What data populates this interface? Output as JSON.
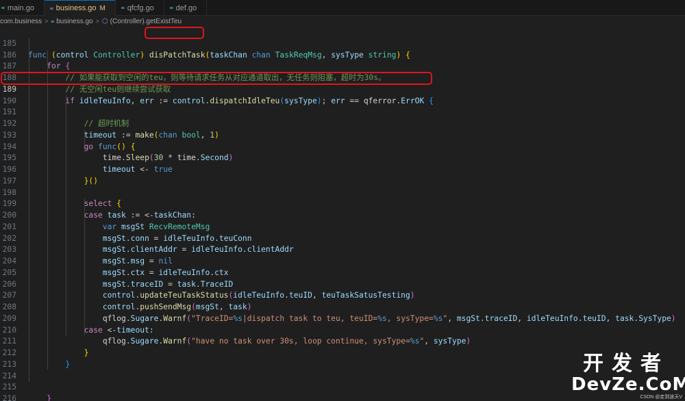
{
  "tabs": [
    {
      "name": "main.go",
      "active": false,
      "modified": ""
    },
    {
      "name": "business.go",
      "active": true,
      "modified": "M"
    },
    {
      "name": "qfcfg.go",
      "active": false,
      "modified": ""
    },
    {
      "name": "def.go",
      "active": false,
      "modified": ""
    }
  ],
  "tab_icon": "go-file-icon",
  "breadcrumb": {
    "folder": "com.business",
    "file": "business.go",
    "symbol": "(Controller).getExistTeu"
  },
  "highlight_color": "#e0161d",
  "line_numbers": [
    "185",
    "186",
    "187",
    "188",
    "189",
    "190",
    "191",
    "192",
    "193",
    "194",
    "195",
    "196",
    "197",
    "198",
    "199",
    "200",
    "201",
    "202",
    "203",
    "204",
    "205",
    "206",
    "207",
    "208",
    "209",
    "210",
    "211",
    "212",
    "213",
    "214",
    "215",
    "216"
  ],
  "current_line": "189",
  "highlights": {
    "function_name": "disPatchTask",
    "line": "189"
  },
  "watermark": {
    "brand_zh": "开发者",
    "brand_en": "DevZe.CoM",
    "credit": "CSDN @走到途天V"
  }
}
